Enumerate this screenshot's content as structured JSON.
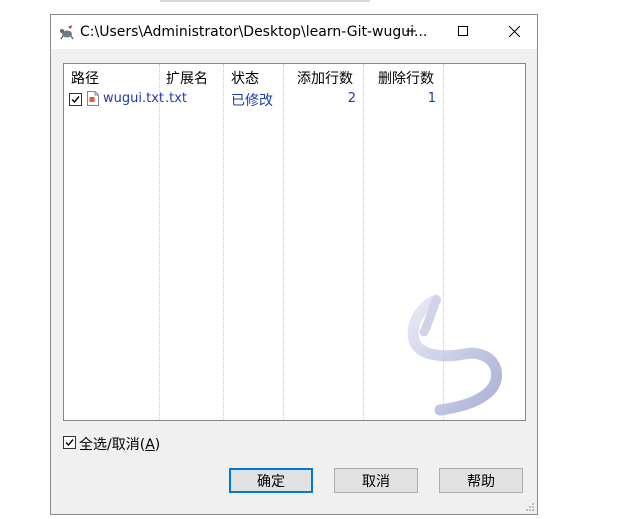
{
  "window": {
    "title": "C:\\Users\\Administrator\\Desktop\\learn-Git-wugui..."
  },
  "table": {
    "columns": [
      "路径",
      "扩展名",
      "状态",
      "添加行数",
      "删除行数"
    ],
    "rows": [
      {
        "checked": true,
        "path": "wugui.txt",
        "extension": ".txt",
        "status": "已修改",
        "added": "2",
        "deleted": "1"
      }
    ]
  },
  "select_all": {
    "checked": true,
    "label_prefix": "全选/取消(",
    "accelerator": "A",
    "label_suffix": ")"
  },
  "buttons": {
    "ok": "确定",
    "cancel": "取消",
    "help": "帮助"
  },
  "icons": {
    "app": "tortoisegit-icon",
    "file": "text-file-icon",
    "watermark": "tortoisegit-logo-watermark"
  },
  "colors": {
    "link_text": "#1a3dab",
    "default_button_border": "#0078d7"
  }
}
